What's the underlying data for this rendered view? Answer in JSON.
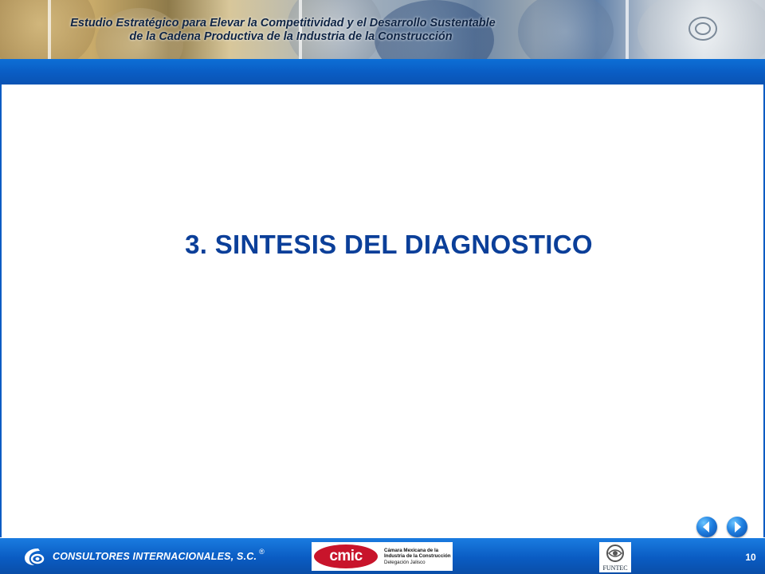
{
  "header": {
    "title_line1": "Estudio Estratégico para Elevar la Competitividad y el Desarrollo Sustentable",
    "title_line2": "de la Cadena Productiva de la Industria de la Construcción"
  },
  "main": {
    "section_title": "3. SINTESIS DEL DIAGNOSTICO"
  },
  "navigation": {
    "prev_icon": "arrow-left-icon",
    "next_icon": "arrow-right-icon"
  },
  "footer": {
    "brand_name": "CONSULTORES INTERNACIONALES, S.C.",
    "brand_reg": "®",
    "cmic_logo": "cmic",
    "cmic_line1": "Cámara Mexicana de la",
    "cmic_line2": "Industria de la Construcción",
    "cmic_line3": "Delegación Jalisco",
    "funtec_label": "FUNTEC",
    "page_number": "10"
  },
  "colors": {
    "band_blue": "#0a5cc3",
    "title_blue": "#0b3f99",
    "cmic_red": "#c8142b"
  }
}
